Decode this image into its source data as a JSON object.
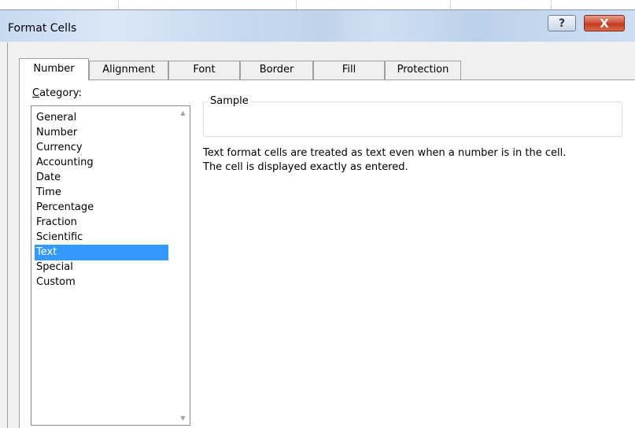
{
  "dialog": {
    "title": "Format Cells",
    "help_glyph": "?",
    "close_glyph": "X"
  },
  "tabs": [
    {
      "label": "Number",
      "active": true
    },
    {
      "label": "Alignment",
      "active": false
    },
    {
      "label": "Font",
      "active": false
    },
    {
      "label": "Border",
      "active": false
    },
    {
      "label": "Fill",
      "active": false
    },
    {
      "label": "Protection",
      "active": false
    }
  ],
  "category": {
    "label_first": "C",
    "label_rest": "ategory:",
    "items": [
      "General",
      "Number",
      "Currency",
      "Accounting",
      "Date",
      "Time",
      "Percentage",
      "Fraction",
      "Scientific",
      "Text",
      "Special",
      "Custom"
    ],
    "selected": "Text"
  },
  "sample": {
    "legend": "Sample",
    "value": ""
  },
  "description": {
    "line1": "Text format cells are treated as text even when a number is in the cell.",
    "line2": "The cell is displayed exactly as entered."
  },
  "colors": {
    "selection": "#3399ff",
    "close_button": "#c23b22",
    "titlebar": "#c8daf0"
  },
  "icons": {
    "help": "help-icon",
    "close": "close-icon",
    "scroll_up": "chevron-up-icon",
    "scroll_down": "chevron-down-icon"
  }
}
